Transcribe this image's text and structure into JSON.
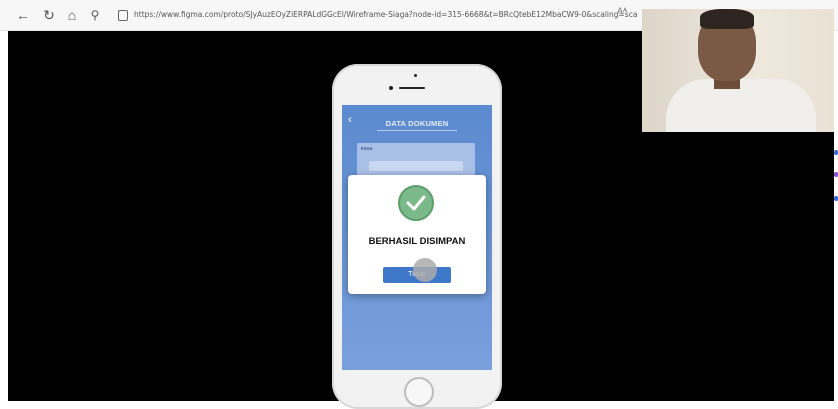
{
  "browser": {
    "url": "https://www.figma.com/proto/SJyAuzEOyZiERPALdGGcEl/Wireframe-Siaga?node-id=315-6668&t=BRcQtebE12MbaCW9-0&scaling=scale...",
    "reader_label": "Aᴬ",
    "icons": [
      "back-icon",
      "refresh-icon",
      "home-icon",
      "search-icon",
      "page-info-icon"
    ]
  },
  "phone_screen": {
    "back_glyph": "‹",
    "title": "DATA DOKUMEN",
    "form_label": "Form"
  },
  "modal": {
    "title": "BERHASIL DISIMPAN",
    "button_label": "Tutup"
  },
  "colors": {
    "accent": "#3f78c8",
    "success": "#7cb98a",
    "screen": "#5c8ad0"
  }
}
